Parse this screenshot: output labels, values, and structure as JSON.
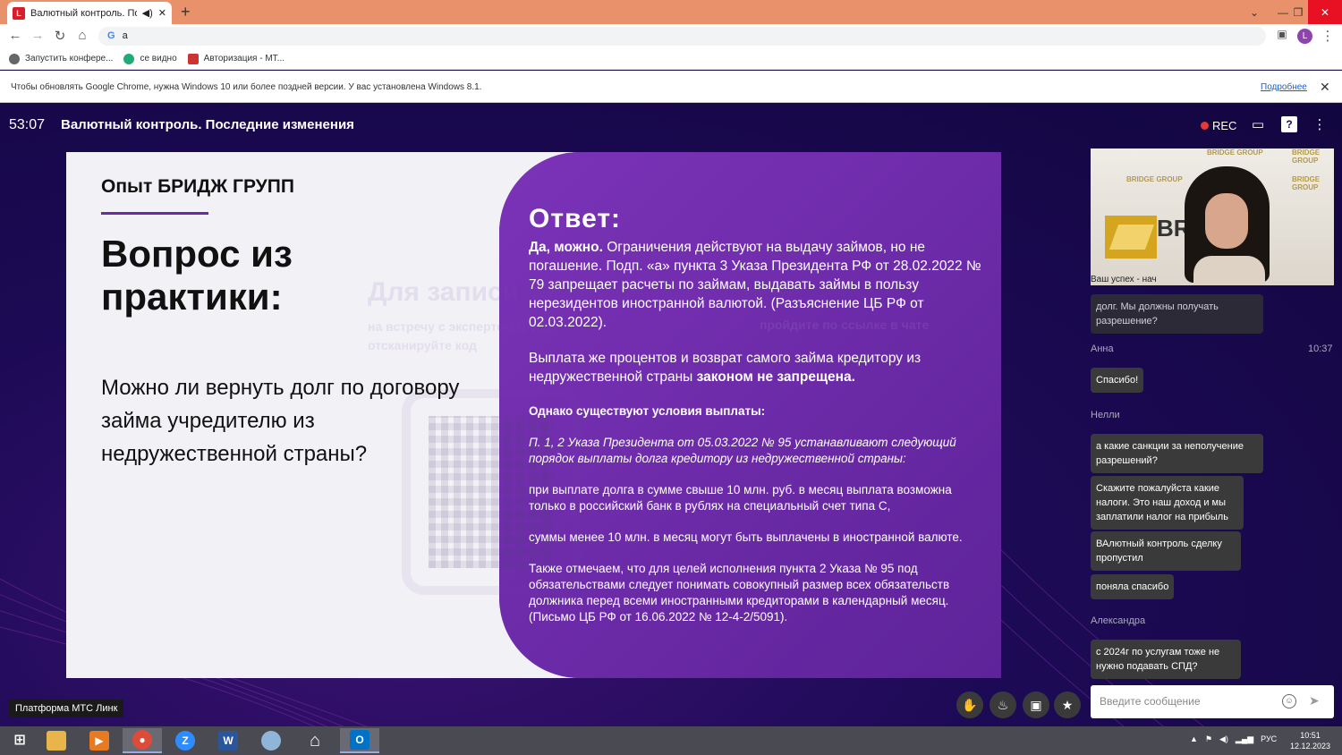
{
  "browser": {
    "tab_title": "Валютный контроль. После",
    "new_tab_symbol": "+",
    "address_text": "a",
    "profile_initial": "L",
    "bookmarks": [
      {
        "label": "Запустить конфере..."
      },
      {
        "label": "се видно"
      },
      {
        "label": "Авторизация - МТ..."
      }
    ],
    "infobar": {
      "message": "Чтобы обновлять Google Chrome, нужна Windows 10 или более поздней версии. У вас установлена Windows 8.1.",
      "link": "Подробнее"
    }
  },
  "webinar": {
    "timer": "53:07",
    "title": "Валютный контроль. Последние изменения",
    "rec_label": "REC",
    "platform_label": "Платформа МТС Линк"
  },
  "slide": {
    "brand": "Опыт БРИДЖ ГРУПП",
    "question_title": "Вопрос из практики:",
    "question_text": "Можно ли вернуть долг по договору займа учредителю из недружественной страны?",
    "ghost_title": "Для записи",
    "ghost_sub1": "на встречу с экспертом групп –",
    "ghost_sub2": "отсканируйте код",
    "ghost_right": "пройдите по ссылке в чате",
    "answer_title": "Ответ:",
    "p1_bold": "Да, можно.",
    "p1_rest": " Ограничения действуют на выдачу займов, но не погашение. Подп. «а» пункта 3 Указа Президента РФ от 28.02.2022 № 79 запрещает расчеты по займам, выдавать займы в пользу нерезидентов иностранной валютой. (Разъяснение ЦБ РФ от 02.03.2022).",
    "p2_start": "Выплата же процентов и возврат самого займа кредитору из недружественной страны ",
    "p2_bold": "законом не запрещена.",
    "p3_bold": "Однако существуют условия выплаты:",
    "p4_italic": "П. 1, 2 Указа Президента от 05.03.2022 № 95 устанавливают следующий порядок выплаты долга кредитору из недружественной страны:",
    "p5": "при выплате долга в сумме свыше 10 млн. руб. в месяц выплата возможна только в российский банк в рублях на специальный счет типа С,",
    "p6": "суммы менее 10 млн. в месяц могут быть выплачены в иностранной валюте.",
    "p7": "Также отмечаем, что для целей исполнения пункта 2 Указа № 95 под обязательствами следует понимать совокупный размер всех обязательств должника перед всеми иностранными кредиторами в календарный месяц. (Письмо ЦБ РФ от 16.06.2022 № 12-4-2/5091)."
  },
  "video": {
    "caption": "Ваш успех - нач",
    "watermark": "BRIDGE GROUP",
    "bg_text": "BR GR"
  },
  "chat": {
    "partial_bubble": "долг. Мы должны получать разрешение?",
    "messages": [
      {
        "sender": "Анна",
        "time": "10:37",
        "text": "Спасибо!"
      },
      {
        "sender": "Нелли",
        "text": "а какие санкции за неполучение разрешений?"
      },
      {
        "text": "Скажите пожалуйста какие налоги. Это наш доход и мы заплатили налог на прибыль"
      },
      {
        "text": "ВАлютный контроль сделку пропустил"
      },
      {
        "text": "поняла спасибо"
      },
      {
        "sender": "Александра",
        "text": "с 2024г по услугам тоже не нужно подавать СПД?"
      }
    ],
    "input_placeholder": "Введите сообщение"
  },
  "taskbar": {
    "language": "РУС",
    "time": "10:51",
    "date": "12.12.2023"
  }
}
